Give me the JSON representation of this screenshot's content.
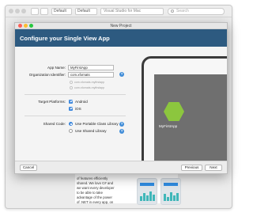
{
  "background_window": {
    "toolbar": {
      "config_dropdown": "Default",
      "device_dropdown": "Default",
      "status": "Visual Studio for Mac",
      "search_placeholder": "Search"
    },
    "doc_text": "of features efficiently\nshared. We love C# and\nwe want every developer\nto be able to take\nadvantage of the power\nof .NET in every app, on"
  },
  "dialog": {
    "window_title": "New Project",
    "heading": "Configure your Single View App",
    "form": {
      "app_name_label": "App Name:",
      "app_name_value": "MyFirstApp",
      "org_id_label": "Organization Identifier:",
      "org_id_value": "com.xfornats",
      "bundle_option_1": "com.xfornats.myfirstapp",
      "bundle_option_2": "com.xfornats.myfirstapp",
      "target_platforms_label": "Target Platforms:",
      "platform_android": "Android",
      "platform_ios": "iOS",
      "shared_code_label": "Shared Code:",
      "shared_pcl": "Use Portable Class Library",
      "shared_shared": "Use Shared Library",
      "help_glyph": "?"
    },
    "preview": {
      "app_name": "MyFirstApp"
    },
    "footer": {
      "cancel": "Cancel",
      "previous": "Previous",
      "next": "Next"
    }
  },
  "colors": {
    "banner": "#2d5a80",
    "accent_blue": "#3a86dd",
    "hex_green": "#8cc63e"
  },
  "icons": [
    "help-icon",
    "checkbox-checked-icon",
    "radio-icon",
    "hexagon-app-icon",
    "search-icon"
  ]
}
